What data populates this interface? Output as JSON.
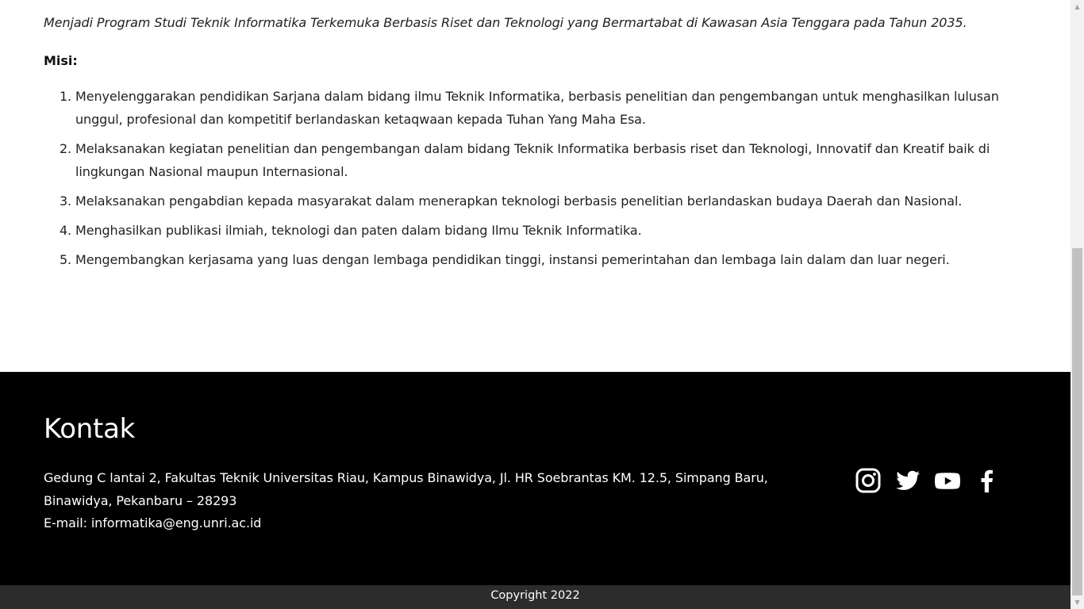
{
  "visi": {
    "text": "Menjadi Program Studi Teknik Informatika Terkemuka Berbasis Riset dan Teknologi yang Bermartabat di Kawasan Asia Tenggara pada Tahun 2035."
  },
  "misi": {
    "heading": "Misi:",
    "items": [
      "Menyelenggarakan pendidikan Sarjana dalam bidang ilmu Teknik Informatika, berbasis penelitian dan pengembangan untuk menghasilkan lulusan unggul, profesional dan kompetitif berlandaskan ketaqwaan kepada Tuhan Yang Maha Esa.",
      "Melaksanakan kegiatan penelitian dan pengembangan dalam bidang Teknik Informatika berbasis riset  dan Teknologi, Innovatif dan Kreatif baik di lingkungan Nasional maupun Internasional.",
      "Melaksanakan pengabdian kepada masyarakat dalam menerapkan teknologi berbasis penelitian berlandaskan budaya Daerah dan Nasional.",
      "Menghasilkan publikasi ilmiah, teknologi dan paten dalam bidang Ilmu Teknik Informatika.",
      "Mengembangkan kerjasama yang luas dengan lembaga pendidikan tinggi, instansi pemerintahan dan lembaga lain dalam dan luar negeri."
    ]
  },
  "footer": {
    "title": "Kontak",
    "address_line1": "Gedung C lantai 2, Fakultas Teknik Universitas Riau, Kampus Binawidya, Jl. HR Soebrantas KM. 12.5, Simpang Baru, Binawidya, Pekanbaru – 28293",
    "email_line": "E-mail: informatika@eng.unri.ac.id",
    "social_icons": [
      "instagram-icon",
      "twitter-icon",
      "youtube-icon",
      "facebook-icon"
    ]
  },
  "copyright": "Copyright 2022",
  "colors": {
    "footer_bg": "#000000",
    "copyright_bg": "#2c2c2c",
    "text": "#222222"
  }
}
